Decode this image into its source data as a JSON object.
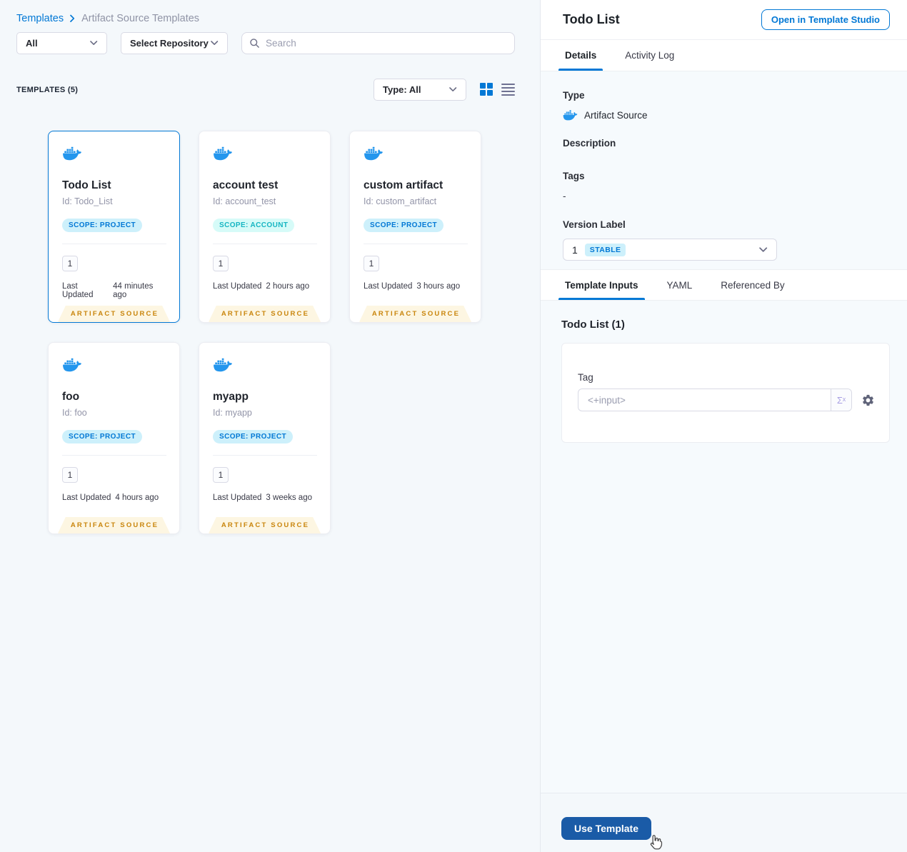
{
  "breadcrumb": {
    "root": "Templates",
    "current": "Artifact Source Templates"
  },
  "filters": {
    "scope_select": "All",
    "repo_select": "Select Repository",
    "search_placeholder": "Search"
  },
  "list_header": {
    "count_label": "TEMPLATES (5)",
    "type_select": "Type: All"
  },
  "cards": [
    {
      "title": "Todo List",
      "id": "Id: Todo_List",
      "scope": "SCOPE: PROJECT",
      "version": "1",
      "updated_label": "Last Updated",
      "updated": "44 minutes ago",
      "badge": "ARTIFACT SOURCE"
    },
    {
      "title": "account test",
      "id": "Id: account_test",
      "scope": "SCOPE: ACCOUNT",
      "version": "1",
      "updated_label": "Last Updated",
      "updated": "2 hours ago",
      "badge": "ARTIFACT SOURCE"
    },
    {
      "title": "custom artifact",
      "id": "Id: custom_artifact",
      "scope": "SCOPE: PROJECT",
      "version": "1",
      "updated_label": "Last Updated",
      "updated": "3 hours ago",
      "badge": "ARTIFACT SOURCE"
    },
    {
      "title": "foo",
      "id": "Id: foo",
      "scope": "SCOPE: PROJECT",
      "version": "1",
      "updated_label": "Last Updated",
      "updated": "4 hours ago",
      "badge": "ARTIFACT SOURCE"
    },
    {
      "title": "myapp",
      "id": "Id: myapp",
      "scope": "SCOPE: PROJECT",
      "version": "1",
      "updated_label": "Last Updated",
      "updated": "3 weeks ago",
      "badge": "ARTIFACT SOURCE"
    }
  ],
  "panel": {
    "title": "Todo List",
    "open_button": "Open in Template Studio",
    "tabs": {
      "details": "Details",
      "activity_log": "Activity Log"
    },
    "details": {
      "type_label": "Type",
      "type_value": "Artifact Source",
      "description_label": "Description",
      "tags_label": "Tags",
      "tags_value": "-",
      "version_label": "Version Label",
      "version_value": "1",
      "version_badge": "STABLE"
    },
    "inputs_tabs": {
      "template_inputs": "Template Inputs",
      "yaml": "YAML",
      "referenced_by": "Referenced By"
    },
    "inputs": {
      "section_title": "Todo List (1)",
      "tag_label": "Tag",
      "tag_value": "<+input>",
      "expression_symbol": "Σˣ"
    },
    "footer": {
      "use_template": "Use Template"
    }
  },
  "icons": {
    "search": "search-icon",
    "chevron": "chevron-down-icon",
    "grid": "grid-view-icon",
    "list": "list-view-icon",
    "docker": "docker-whale-icon",
    "expression": "expression-sigma-icon",
    "gear": "gear-icon",
    "cursor": "hand-pointer-cursor"
  },
  "colors": {
    "primary_blue": "#0278D5",
    "docker_blue": "#2496ED",
    "use_template_bg": "#1A5BA7",
    "scope_project_bg": "#CDF0FB",
    "scope_account_bg": "#D6FBF8",
    "scope_account_text": "#16B5C2",
    "ribbon_bg": "#FDF6E2",
    "ribbon_text": "#C9850C",
    "left_bg": "#F4F8FB",
    "right_bg": "#F6FAFD"
  }
}
